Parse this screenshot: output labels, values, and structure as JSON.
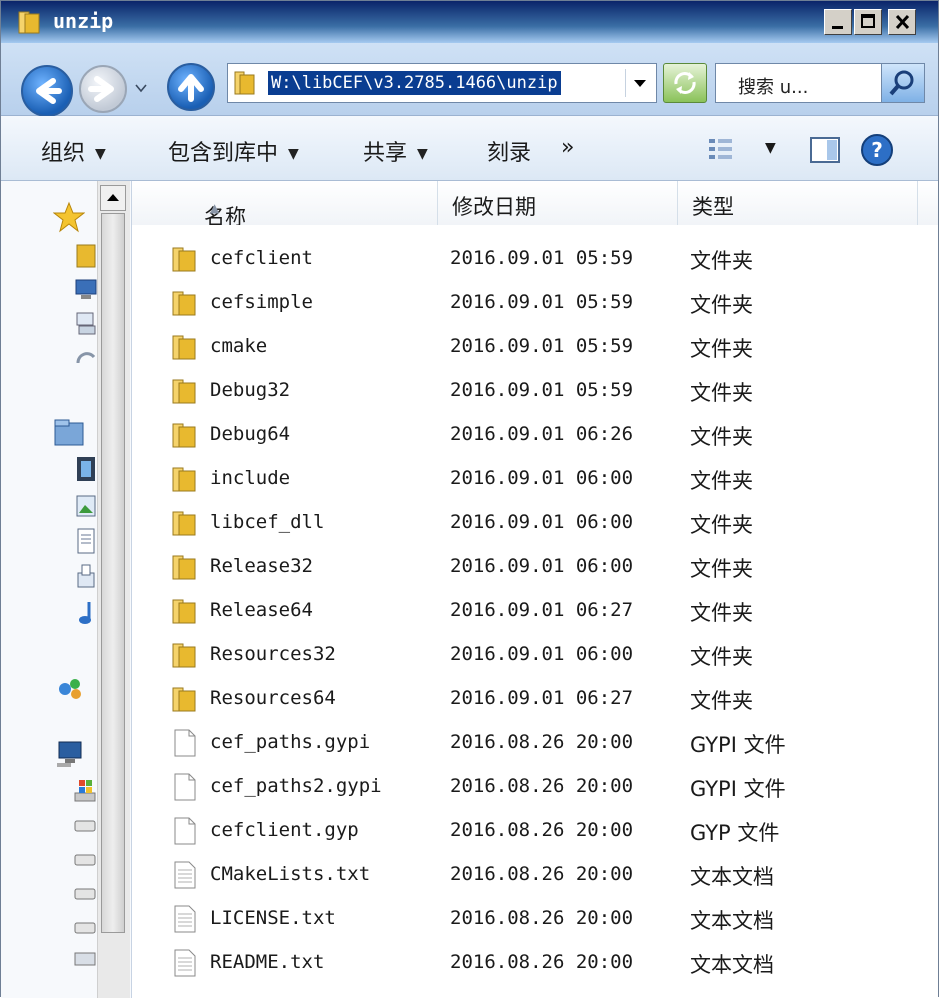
{
  "window": {
    "title": "unzip",
    "minimize_label": "minimize",
    "maximize_label": "maximize",
    "close_label": "close"
  },
  "navbar": {
    "address": "W:\\libCEF\\v3.2785.1466\\unzip",
    "search_placeholder": "搜索 u..."
  },
  "commandbar": {
    "organize": "组织",
    "include_in_library": "包含到库中",
    "share": "共享",
    "burn": "刻录",
    "more": "»"
  },
  "columns": {
    "name": "名称",
    "modified": "修改日期",
    "type": "类型"
  },
  "files": [
    {
      "name": "cefclient",
      "date": "2016.09.01 05:59",
      "type": "文件夹",
      "icon": "folder-icon"
    },
    {
      "name": "cefsimple",
      "date": "2016.09.01 05:59",
      "type": "文件夹",
      "icon": "folder-icon"
    },
    {
      "name": "cmake",
      "date": "2016.09.01 05:59",
      "type": "文件夹",
      "icon": "folder-icon"
    },
    {
      "name": "Debug32",
      "date": "2016.09.01 05:59",
      "type": "文件夹",
      "icon": "folder-icon"
    },
    {
      "name": "Debug64",
      "date": "2016.09.01 06:26",
      "type": "文件夹",
      "icon": "folder-icon"
    },
    {
      "name": "include",
      "date": "2016.09.01 06:00",
      "type": "文件夹",
      "icon": "folder-icon"
    },
    {
      "name": "libcef_dll",
      "date": "2016.09.01 06:00",
      "type": "文件夹",
      "icon": "folder-icon"
    },
    {
      "name": "Release32",
      "date": "2016.09.01 06:00",
      "type": "文件夹",
      "icon": "folder-icon"
    },
    {
      "name": "Release64",
      "date": "2016.09.01 06:27",
      "type": "文件夹",
      "icon": "folder-icon"
    },
    {
      "name": "Resources32",
      "date": "2016.09.01 06:00",
      "type": "文件夹",
      "icon": "folder-icon"
    },
    {
      "name": "Resources64",
      "date": "2016.09.01 06:27",
      "type": "文件夹",
      "icon": "folder-icon"
    },
    {
      "name": "cef_paths.gypi",
      "date": "2016.08.26 20:00",
      "type": "GYPI 文件",
      "icon": "file-icon"
    },
    {
      "name": "cef_paths2.gypi",
      "date": "2016.08.26 20:00",
      "type": "GYPI 文件",
      "icon": "file-icon"
    },
    {
      "name": "cefclient.gyp",
      "date": "2016.08.26 20:00",
      "type": "GYP 文件",
      "icon": "file-icon"
    },
    {
      "name": "CMakeLists.txt",
      "date": "2016.08.26 20:00",
      "type": "文本文档",
      "icon": "text-file-icon"
    },
    {
      "name": "LICENSE.txt",
      "date": "2016.08.26 20:00",
      "type": "文本文档",
      "icon": "text-file-icon"
    },
    {
      "name": "README.txt",
      "date": "2016.08.26 20:00",
      "type": "文本文档",
      "icon": "text-file-icon"
    }
  ],
  "colors": {
    "title_bar": "#0a246a",
    "selection": "#0a3d91",
    "folder": "#e8b92f"
  }
}
